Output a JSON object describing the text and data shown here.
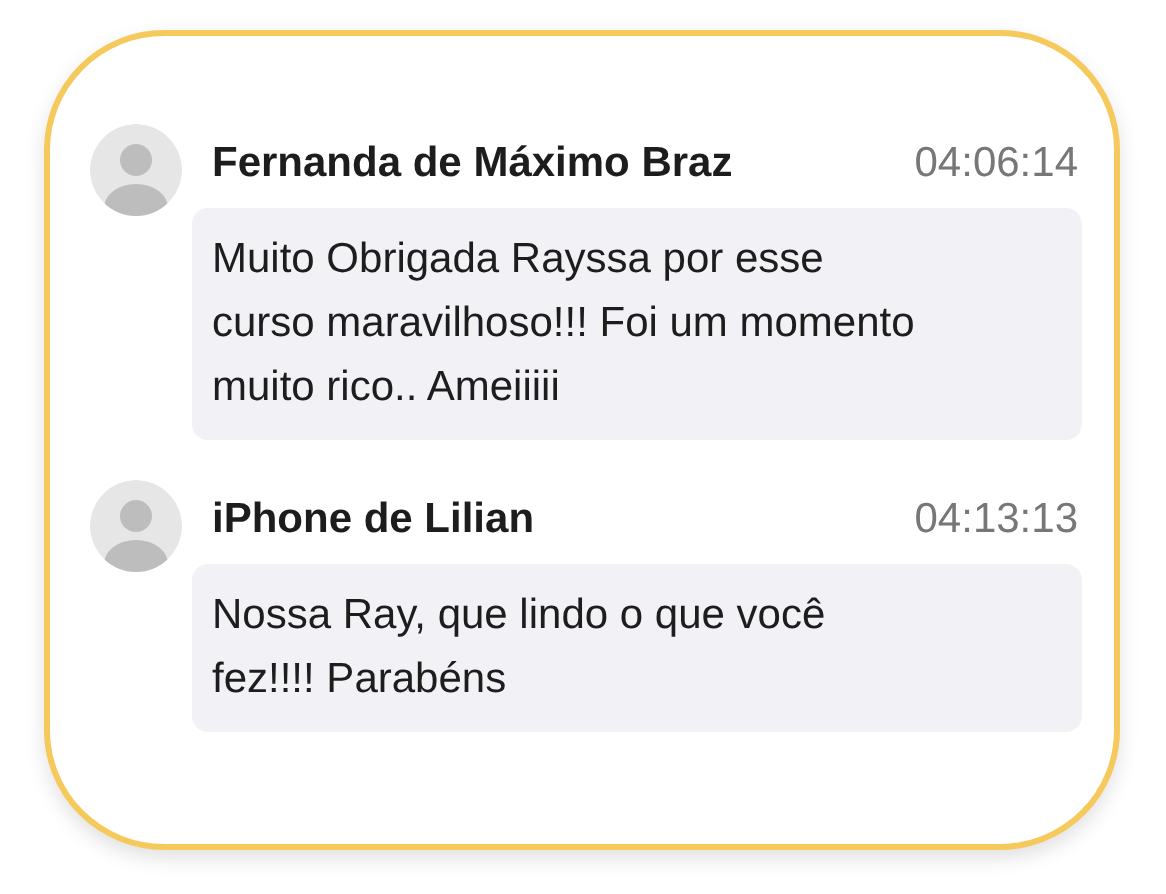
{
  "messages": [
    {
      "author": "Fernanda de Máximo Braz",
      "time": "04:06:14",
      "text": "Muito Obrigada Rayssa por esse curso maravilhoso!!! Foi um momento muito rico.. Ameiiiii"
    },
    {
      "author": "iPhone de Lilian",
      "time": "04:13:13",
      "text": "Nossa Ray, que lindo o que você fez!!!! Parabéns"
    }
  ]
}
